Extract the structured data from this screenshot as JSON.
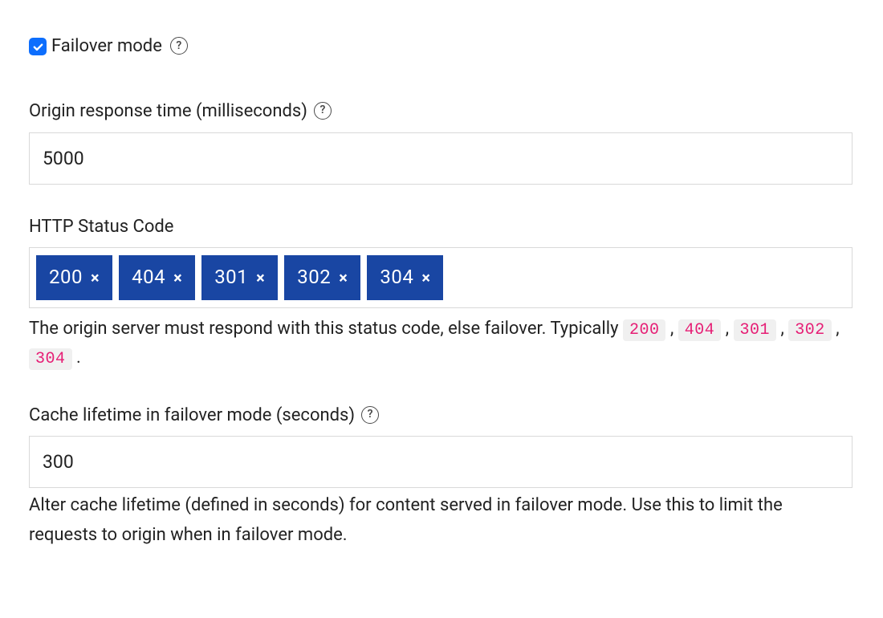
{
  "failover": {
    "checkbox_label": "Failover mode",
    "checked": true
  },
  "origin_response_time": {
    "label": "Origin response time (milliseconds)",
    "value": "5000"
  },
  "http_status_code": {
    "label": "HTTP Status Code",
    "tags": [
      "200",
      "404",
      "301",
      "302",
      "304"
    ],
    "help_prefix": "The origin server must respond with this status code, else failover. Typically ",
    "help_codes": [
      "200",
      "404",
      "301",
      "302",
      "304"
    ],
    "help_suffix": "."
  },
  "cache_lifetime": {
    "label": "Cache lifetime in failover mode (seconds)",
    "value": "300",
    "help": "Alter cache lifetime (defined in seconds) for content served in failover mode. Use this to limit the requests to origin when in failover mode."
  }
}
